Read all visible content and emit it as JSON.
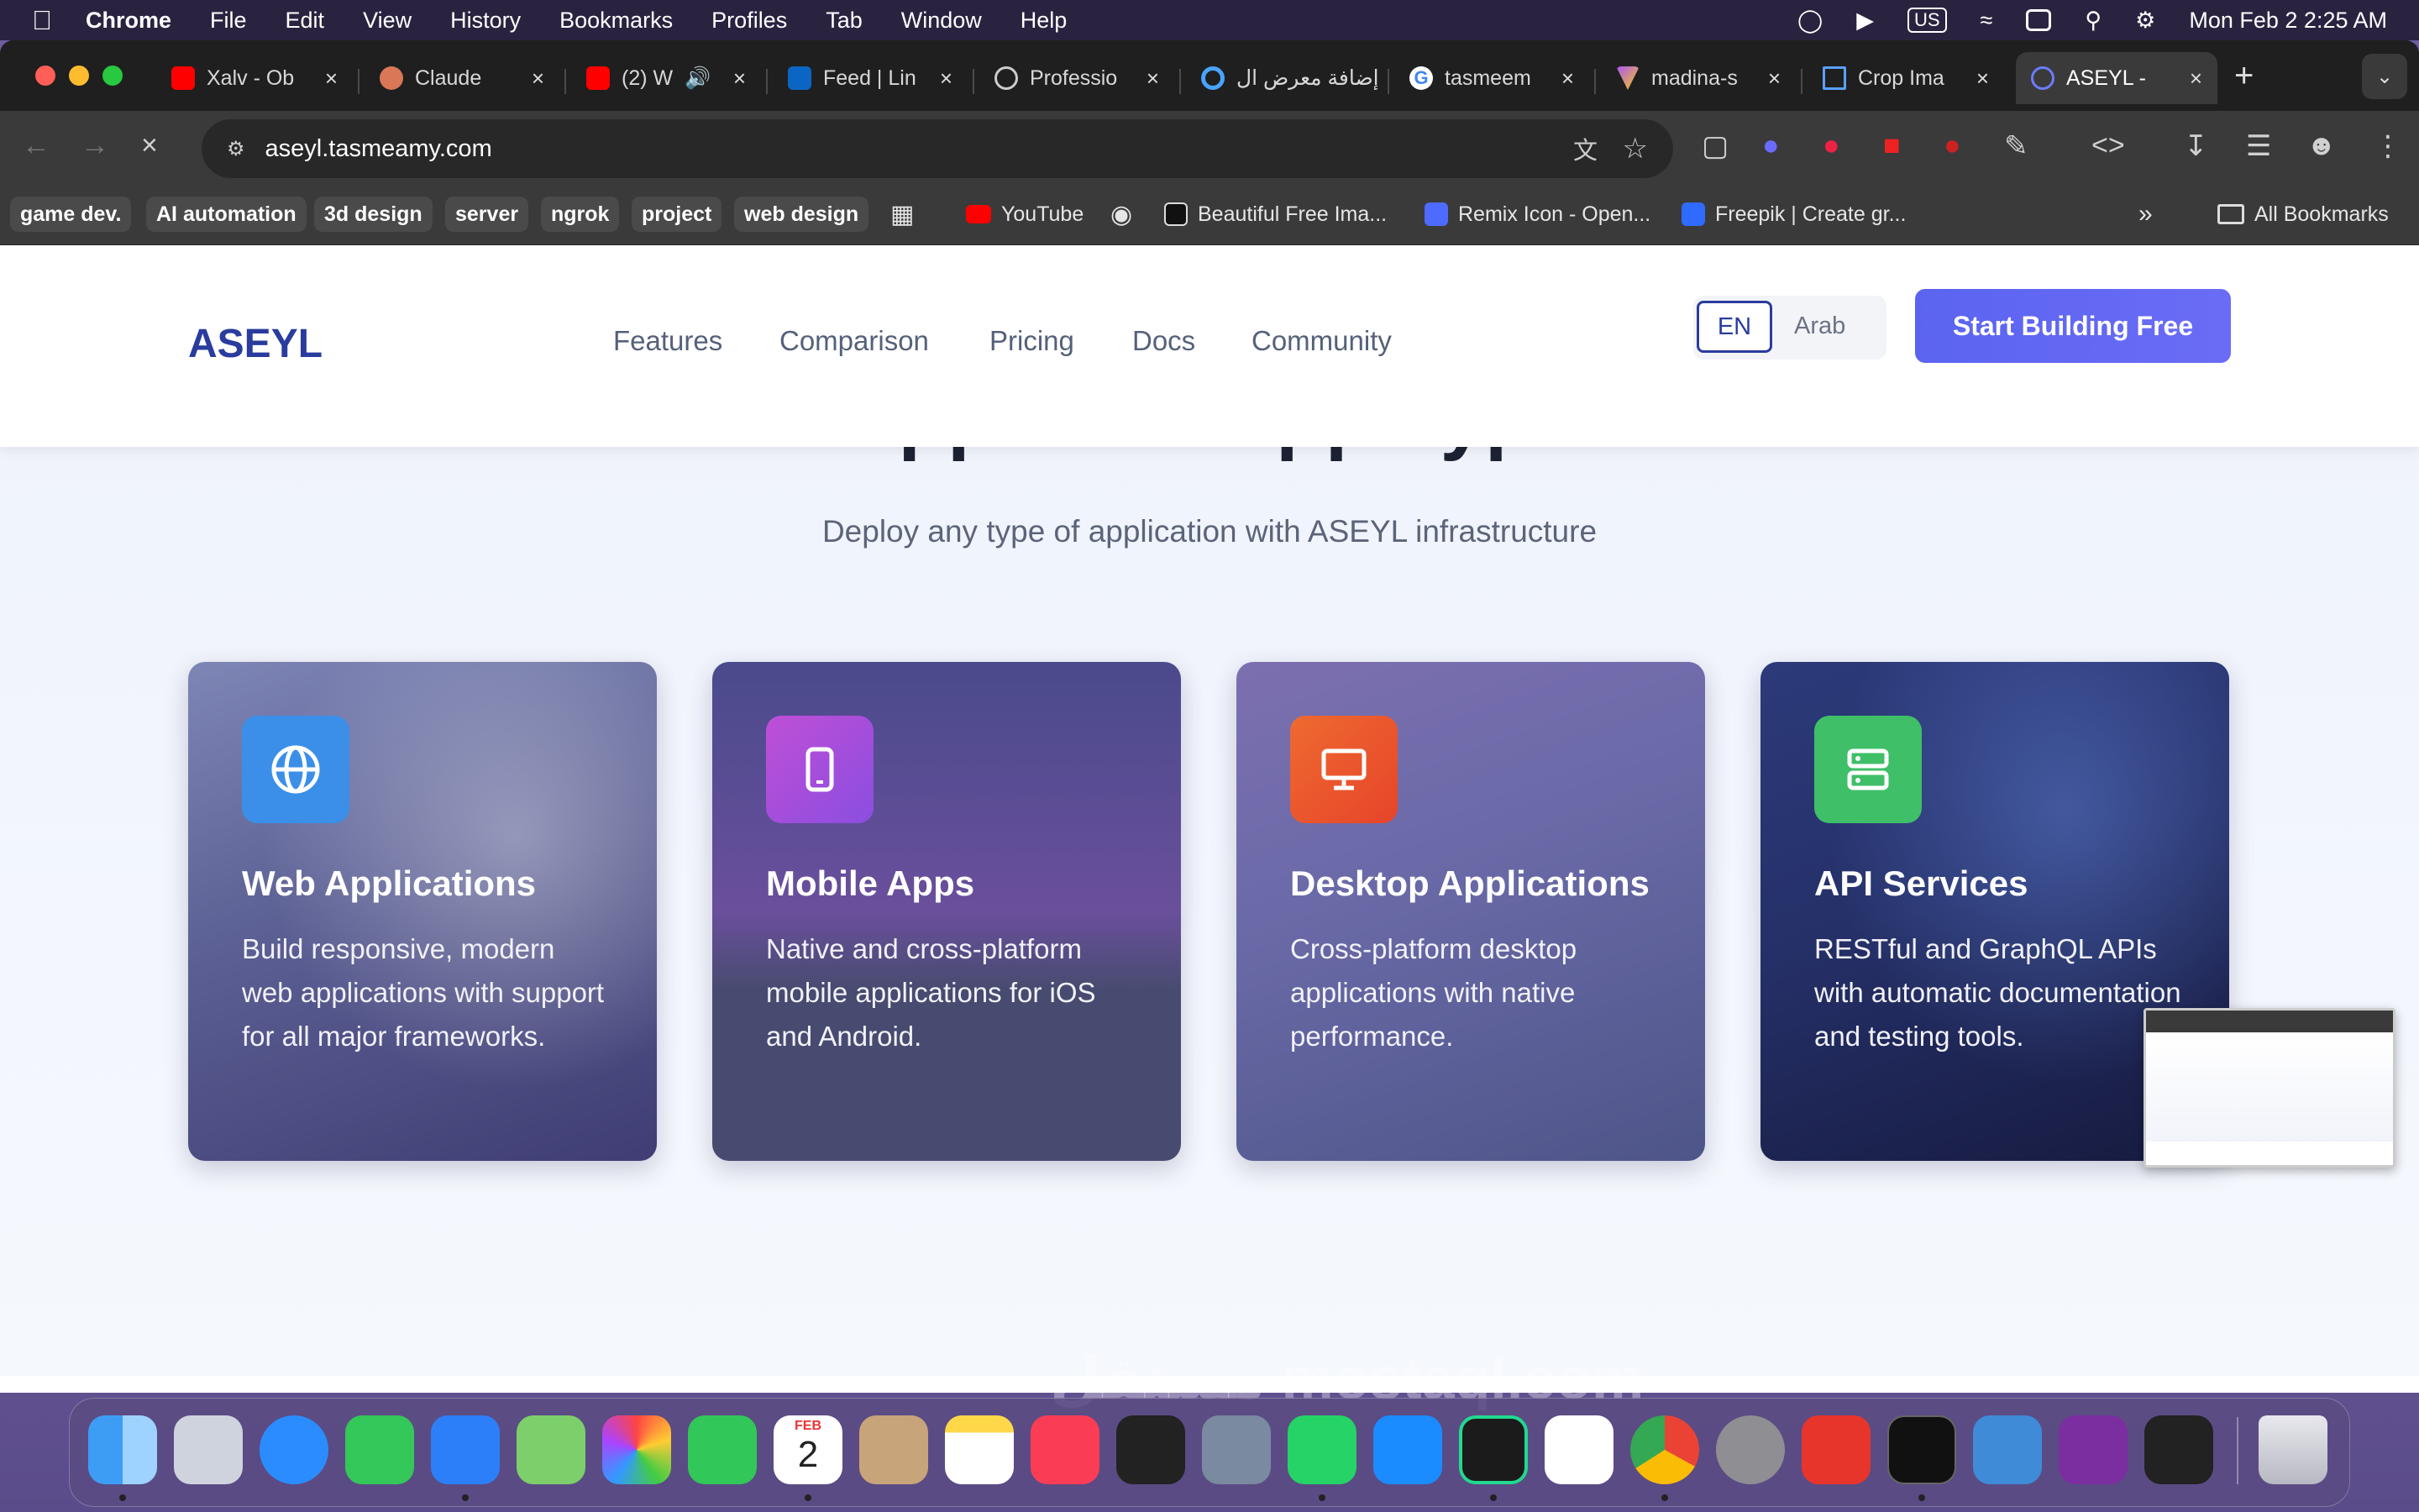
{
  "menubar": {
    "app": "Chrome",
    "items": [
      "File",
      "Edit",
      "View",
      "History",
      "Bookmarks",
      "Profiles",
      "Tab",
      "Window",
      "Help"
    ],
    "keyboard": "US",
    "clock": "Mon Feb 2  2:25 AM"
  },
  "tabs": [
    {
      "title": "Xalv - Ob",
      "favicon": "youtube-icon",
      "color": "#ff0000"
    },
    {
      "title": "Claude",
      "favicon": "claude-icon",
      "color": "#d97757"
    },
    {
      "title": "(2) W",
      "favicon": "youtube-icon",
      "color": "#ff0000"
    },
    {
      "title": "Feed | Lin",
      "favicon": "linkedin-icon",
      "color": "#0a66c2"
    },
    {
      "title": "Professio",
      "favicon": "chatgpt-icon",
      "color": "#cccccc"
    },
    {
      "title": "إضافة معرض ال",
      "favicon": "circle-icon",
      "color": "#4aa3ff"
    },
    {
      "title": "tasmeem",
      "favicon": "google-icon",
      "color": "#4285f4"
    },
    {
      "title": "madina-s",
      "favicon": "vite-icon",
      "color": "#a855f7"
    },
    {
      "title": "Crop Ima",
      "favicon": "crop-icon",
      "color": "#5aa0ff"
    },
    {
      "title": "ASEYL -",
      "favicon": "aseyl-icon",
      "color": "#6b7cff"
    }
  ],
  "address": "aseyl.tasmeamy.com",
  "bookmark_chips": [
    "game dev.",
    "AI automation",
    "3d design",
    "server",
    "ngrok",
    "project",
    "web design"
  ],
  "bookmark_links": [
    "YouTube",
    "Beautiful Free Ima...",
    "Remix Icon - Open...",
    "Freepik | Create gr..."
  ],
  "all_bookmarks": "All Bookmarks",
  "site": {
    "logo": "ASEYL",
    "nav": [
      "Features",
      "Comparison",
      "Pricing",
      "Docs",
      "Community"
    ],
    "lang_en": "EN",
    "lang_ar": "Arab",
    "cta": "Start Building Free",
    "section_title": "Supported App Types",
    "section_subtitle": "Deploy any type of application with ASEYL infrastructure",
    "cards": [
      {
        "title": "Web Applications",
        "desc": "Build responsive, modern web applications with support for all major frameworks.",
        "icon": "globe-icon",
        "badge": "#3b8fe8"
      },
      {
        "title": "Mobile Apps",
        "desc": "Native and cross-platform mobile applications for iOS and Android.",
        "icon": "phone-icon",
        "badge": "#b24fd6"
      },
      {
        "title": "Desktop Applications",
        "desc": "Cross-platform desktop applications with native performance.",
        "icon": "monitor-icon",
        "badge": "#ee5a2c"
      },
      {
        "title": "API Services",
        "desc": "RESTful and GraphQL APIs with automatic documentation and testing tools.",
        "icon": "server-icon",
        "badge": "#3fbf68"
      }
    ]
  },
  "watermark": "مستقل mostaql.com",
  "dock": [
    "Finder",
    "Launchpad",
    "Safari",
    "Messages",
    "Mail",
    "Maps",
    "Photos",
    "FaceTime",
    "Calendar",
    "Contacts",
    "Notes",
    "Music",
    "Activity",
    "Simulator",
    "WhatsApp",
    "App Store",
    "PyCharm",
    "VS Code",
    "Chrome",
    "Settings",
    "WPS",
    "Terminal",
    "Files",
    "Loop",
    "Monitor",
    "Trash"
  ],
  "calendar": {
    "month": "FEB",
    "day": "2"
  }
}
